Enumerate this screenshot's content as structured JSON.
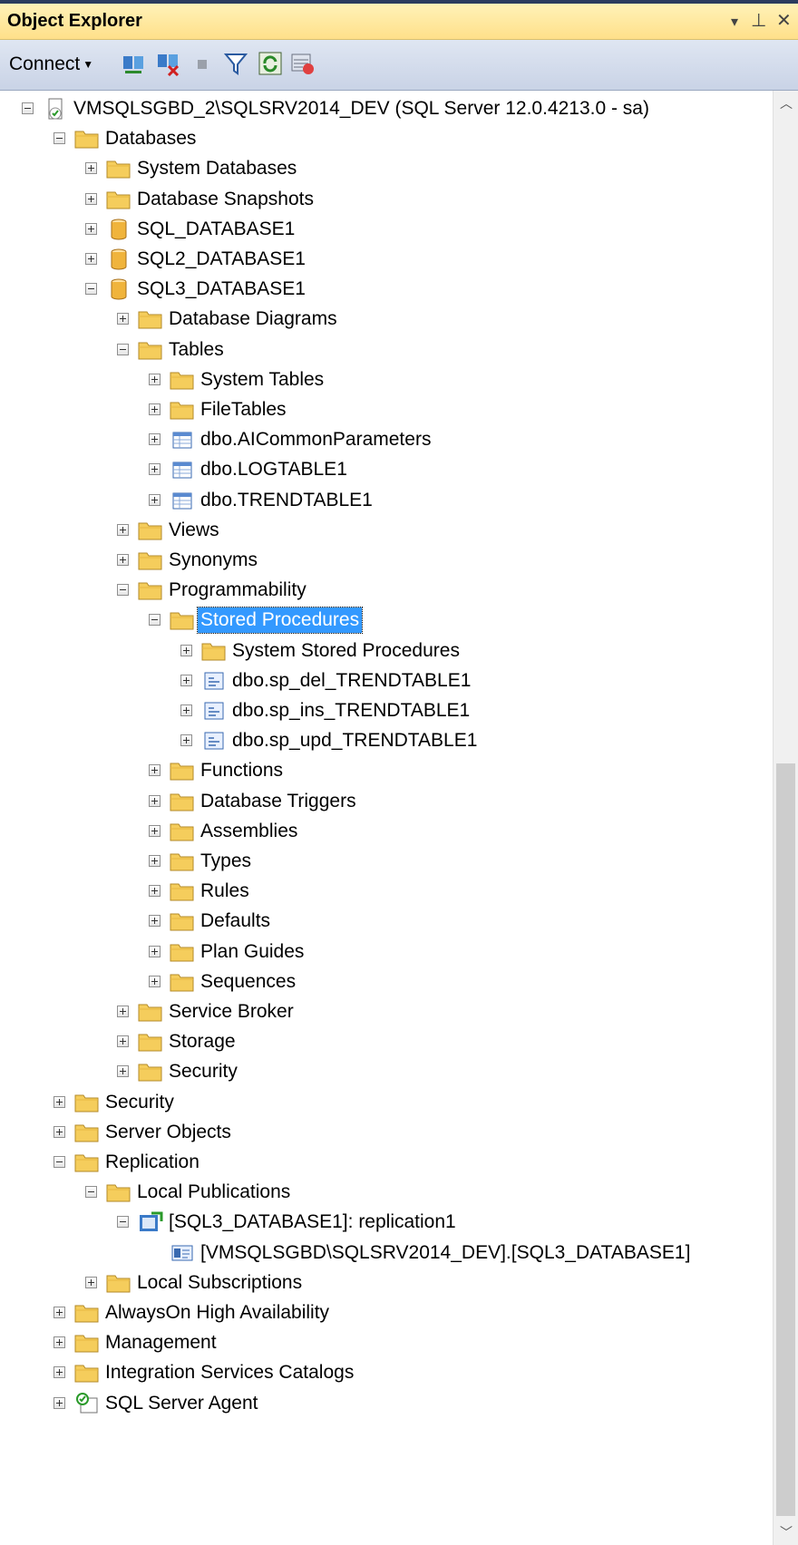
{
  "panel": {
    "title": "Object Explorer",
    "controls": [
      "▾",
      "⊥",
      "✕"
    ]
  },
  "toolbar": {
    "connect_label": "Connect",
    "icons": [
      "connect-object-explorer-icon",
      "disconnect-icon",
      "stop-icon",
      "filter-icon",
      "refresh-icon",
      "activity-monitor-icon"
    ]
  },
  "tree": [
    {
      "label": "VMSQLSGBD_2\\SQLSRV2014_DEV (SQL Server 12.0.4213.0 - sa)",
      "level": 0,
      "icon": "server",
      "state": "expanded"
    },
    {
      "label": "Databases",
      "level": 1,
      "icon": "folder",
      "state": "expanded"
    },
    {
      "label": "System Databases",
      "level": 2,
      "icon": "folder",
      "state": "collapsed"
    },
    {
      "label": "Database Snapshots",
      "level": 2,
      "icon": "folder",
      "state": "collapsed"
    },
    {
      "label": "SQL_DATABASE1",
      "level": 2,
      "icon": "database",
      "state": "collapsed"
    },
    {
      "label": "SQL2_DATABASE1",
      "level": 2,
      "icon": "database",
      "state": "collapsed"
    },
    {
      "label": "SQL3_DATABASE1",
      "level": 2,
      "icon": "database",
      "state": "expanded"
    },
    {
      "label": "Database Diagrams",
      "level": 3,
      "icon": "folder",
      "state": "collapsed"
    },
    {
      "label": "Tables",
      "level": 3,
      "icon": "folder",
      "state": "expanded"
    },
    {
      "label": "System Tables",
      "level": 4,
      "icon": "folder",
      "state": "collapsed"
    },
    {
      "label": "FileTables",
      "level": 4,
      "icon": "folder",
      "state": "collapsed"
    },
    {
      "label": "dbo.AICommonParameters",
      "level": 4,
      "icon": "table",
      "state": "collapsed"
    },
    {
      "label": "dbo.LOGTABLE1",
      "level": 4,
      "icon": "table",
      "state": "collapsed"
    },
    {
      "label": "dbo.TRENDTABLE1",
      "level": 4,
      "icon": "table",
      "state": "collapsed"
    },
    {
      "label": "Views",
      "level": 3,
      "icon": "folder",
      "state": "collapsed"
    },
    {
      "label": "Synonyms",
      "level": 3,
      "icon": "folder",
      "state": "collapsed"
    },
    {
      "label": "Programmability",
      "level": 3,
      "icon": "folder",
      "state": "expanded"
    },
    {
      "label": "Stored Procedures",
      "level": 4,
      "icon": "folder",
      "state": "expanded",
      "selected": true
    },
    {
      "label": "System Stored Procedures",
      "level": 5,
      "icon": "folder",
      "state": "collapsed"
    },
    {
      "label": "dbo.sp_del_TRENDTABLE1",
      "level": 5,
      "icon": "procedure",
      "state": "collapsed"
    },
    {
      "label": "dbo.sp_ins_TRENDTABLE1",
      "level": 5,
      "icon": "procedure",
      "state": "collapsed"
    },
    {
      "label": "dbo.sp_upd_TRENDTABLE1",
      "level": 5,
      "icon": "procedure",
      "state": "collapsed"
    },
    {
      "label": "Functions",
      "level": 4,
      "icon": "folder",
      "state": "collapsed"
    },
    {
      "label": "Database Triggers",
      "level": 4,
      "icon": "folder",
      "state": "collapsed"
    },
    {
      "label": "Assemblies",
      "level": 4,
      "icon": "folder",
      "state": "collapsed"
    },
    {
      "label": "Types",
      "level": 4,
      "icon": "folder",
      "state": "collapsed"
    },
    {
      "label": "Rules",
      "level": 4,
      "icon": "folder",
      "state": "collapsed"
    },
    {
      "label": "Defaults",
      "level": 4,
      "icon": "folder",
      "state": "collapsed"
    },
    {
      "label": "Plan Guides",
      "level": 4,
      "icon": "folder",
      "state": "collapsed"
    },
    {
      "label": "Sequences",
      "level": 4,
      "icon": "folder",
      "state": "collapsed"
    },
    {
      "label": "Service Broker",
      "level": 3,
      "icon": "folder",
      "state": "collapsed"
    },
    {
      "label": "Storage",
      "level": 3,
      "icon": "folder",
      "state": "collapsed"
    },
    {
      "label": "Security",
      "level": 3,
      "icon": "folder",
      "state": "collapsed"
    },
    {
      "label": "Security",
      "level": 1,
      "icon": "folder",
      "state": "collapsed"
    },
    {
      "label": "Server Objects",
      "level": 1,
      "icon": "folder",
      "state": "collapsed"
    },
    {
      "label": "Replication",
      "level": 1,
      "icon": "folder",
      "state": "expanded"
    },
    {
      "label": "Local Publications",
      "level": 2,
      "icon": "folder",
      "state": "expanded"
    },
    {
      "label": "[SQL3_DATABASE1]: replication1",
      "level": 3,
      "icon": "publication",
      "state": "expanded"
    },
    {
      "label": "[VMSQLSGBD\\SQLSRV2014_DEV].[SQL3_DATABASE1]",
      "level": 4,
      "icon": "subscription",
      "state": "leaf"
    },
    {
      "label": "Local Subscriptions",
      "level": 2,
      "icon": "folder",
      "state": "collapsed"
    },
    {
      "label": "AlwaysOn High Availability",
      "level": 1,
      "icon": "folder",
      "state": "collapsed"
    },
    {
      "label": "Management",
      "level": 1,
      "icon": "folder",
      "state": "collapsed"
    },
    {
      "label": "Integration Services Catalogs",
      "level": 1,
      "icon": "folder",
      "state": "collapsed"
    },
    {
      "label": "SQL Server Agent",
      "level": 1,
      "icon": "agent",
      "state": "collapsed"
    }
  ],
  "colors": {
    "selection": "#3399ff",
    "folder": "#f5cd5c",
    "database": "#f0b43c",
    "titlebar": "#ffe08a"
  }
}
